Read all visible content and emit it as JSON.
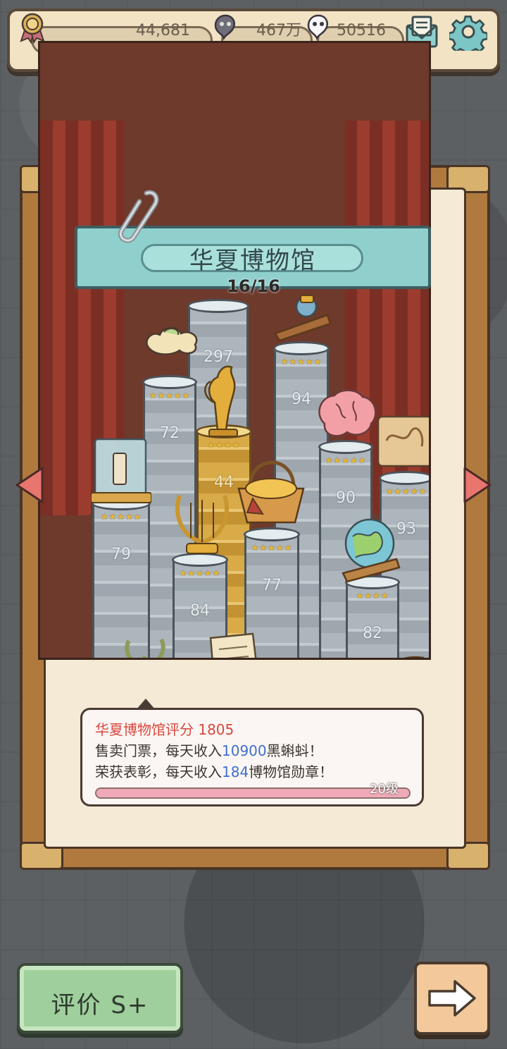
{
  "resources": {
    "medals": "44,681",
    "black_tadpoles": "467万",
    "tadpoles": "50516"
  },
  "icons": {
    "medal": "medal-icon",
    "black_tadpole": "black-tadpole-icon",
    "white_tadpole": "white-tadpole-icon",
    "mail": "mail-icon",
    "settings": "gear-icon"
  },
  "museum": {
    "name": "华夏博物馆",
    "progress": "16/16",
    "pillars": [
      {
        "number": "297"
      },
      {
        "number": "72"
      },
      {
        "number": "94"
      },
      {
        "number": "44"
      },
      {
        "number": "79"
      },
      {
        "number": "90"
      },
      {
        "number": "93"
      },
      {
        "number": "84"
      },
      {
        "number": "77"
      },
      {
        "number": "82"
      }
    ]
  },
  "info": {
    "rating_label": "华夏博物馆评分",
    "rating_value": "1805",
    "ticket_prefix": "售卖门票，每天收入",
    "ticket_amount": "10900",
    "ticket_suffix": "黑蝌蚪！",
    "honor_prefix": "荣获表彰，每天收入",
    "honor_amount": "184",
    "honor_suffix": "博物馆勋章！",
    "level": "20级",
    "level_progress_percent": 100
  },
  "buttons": {
    "rating": "评价 S+"
  },
  "colors": {
    "accent_red": "#d8473e",
    "accent_blue": "#3e6fd0",
    "banner_teal": "#8fd0cd",
    "rating_green": "#9fcf9c"
  }
}
